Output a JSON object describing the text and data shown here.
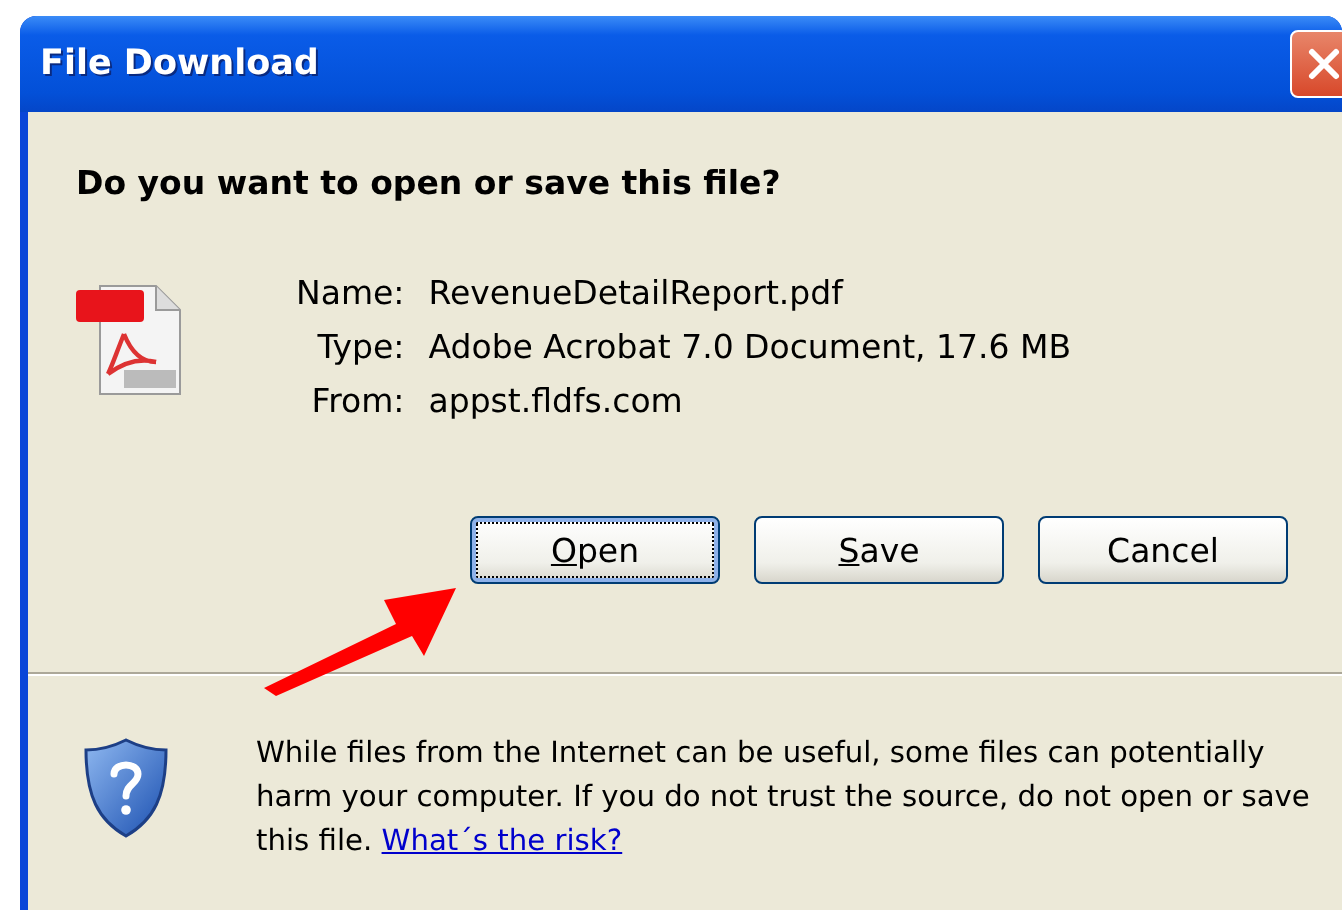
{
  "window": {
    "title": "File Download"
  },
  "question": "Do you want to open or save this file?",
  "file_info": [
    {
      "label": "Name:",
      "value": "RevenueDetailReport.pdf"
    },
    {
      "label": "Type:",
      "value": "Adobe Acrobat 7.0 Document, 17.6 MB"
    },
    {
      "label": "From:",
      "value": "appst.fldfs.com"
    }
  ],
  "buttons": [
    {
      "label": "Open",
      "focused": true,
      "mnemonic": true
    },
    {
      "label": "Save",
      "focused": false,
      "mnemonic": true
    },
    {
      "label": "Cancel",
      "focused": false,
      "mnemonic": false
    }
  ],
  "annotation": {
    "kind": "arrow"
  },
  "warning": {
    "text": "While files from the Internet can be useful, some files can potentially harm your computer. If you do not trust the source, do not open or save this file.",
    "link": "What´s the risk?"
  }
}
